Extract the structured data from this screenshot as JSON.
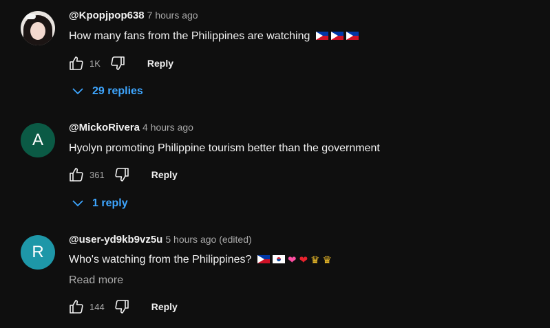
{
  "comments": [
    {
      "author": "@Kpopjpop638",
      "time": "7 hours ago",
      "text": "How many fans from the Philippines are watching",
      "likes": "1K",
      "reply_label": "Reply",
      "replies_label": "29 replies",
      "avatar_type": "photo"
    },
    {
      "author": "@MickoRivera",
      "time": "4 hours ago",
      "text": "Hyolyn promoting Philippine tourism better than the government",
      "likes": "361",
      "reply_label": "Reply",
      "replies_label": "1 reply",
      "avatar_letter": "A",
      "avatar_color": "#0b5a45"
    },
    {
      "author": "@user-yd9kb9vz5u",
      "time": "5 hours ago (edited)",
      "text": "Who's watching from the Philippines?",
      "likes": "144",
      "reply_label": "Reply",
      "read_more": "Read more",
      "avatar_letter": "R",
      "avatar_color": "#1e97a8"
    }
  ],
  "icons": {
    "like": "thumbs-up-icon",
    "dislike": "thumbs-down-icon",
    "expand": "chevron-down-icon"
  },
  "colors": {
    "background": "#0f0f0f",
    "link": "#3ea6ff",
    "secondary_text": "#aaaaaa"
  }
}
